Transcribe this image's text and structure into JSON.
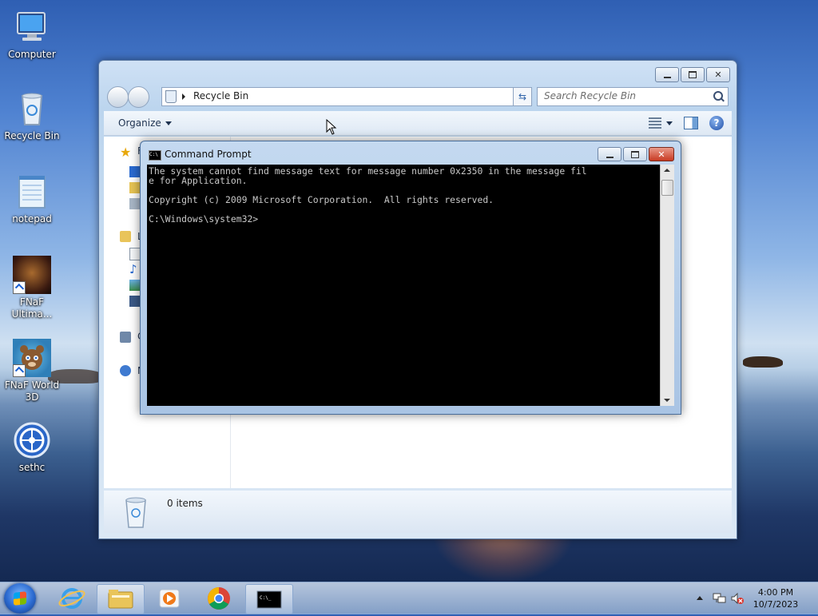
{
  "desktop": {
    "icons": [
      {
        "label": "Computer"
      },
      {
        "label": "Recycle Bin"
      },
      {
        "label": "notepad"
      },
      {
        "label": "FNaF Ultima..."
      },
      {
        "label": "FNaF World 3D"
      },
      {
        "label": "sethc"
      }
    ]
  },
  "explorer": {
    "address": "Recycle Bin",
    "search_placeholder": "Search Recycle Bin",
    "organize_label": "Organize",
    "status_count": "0 items",
    "navpane_partial": [
      "F",
      "L",
      "C",
      "N"
    ]
  },
  "cmd": {
    "title": "Command Prompt",
    "icon_text": "C:\\",
    "lines": [
      "The system cannot find message text for message number 0x2350 in the message fil",
      "e for Application.",
      "",
      "Copyright (c) 2009 Microsoft Corporation.  All rights reserved.",
      "",
      "C:\\Windows\\system32>"
    ]
  },
  "taskbar": {
    "apps": [
      "start-button",
      "internet-explorer",
      "windows-explorer",
      "media-player",
      "chrome",
      "command-prompt"
    ],
    "tray_icons": [
      "show-hidden-icons-arrow",
      "network-icon",
      "volume-muted-icon"
    ],
    "time": "4:00 PM",
    "date": "10/7/2023"
  }
}
